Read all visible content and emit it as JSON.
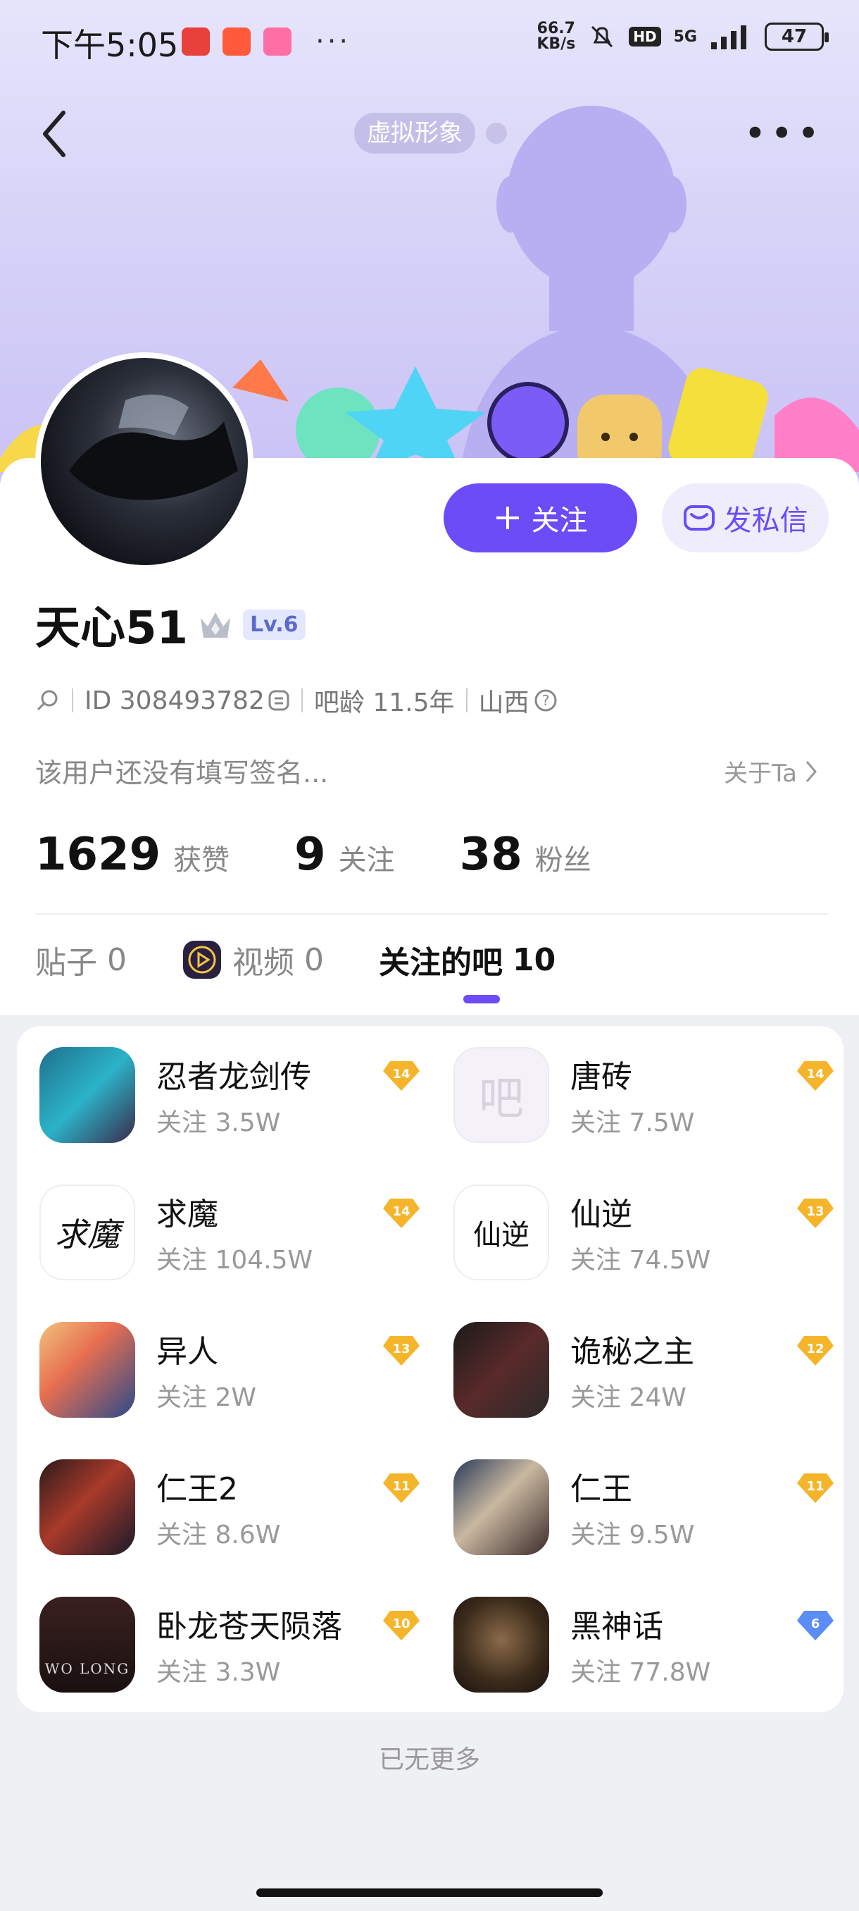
{
  "status_bar": {
    "time": "下午5:05",
    "net_speed_value": "66.7",
    "net_speed_unit": "KB/s",
    "hd": "HD",
    "network": "5G",
    "battery": "47",
    "more": "···"
  },
  "header": {
    "virtual_label": "虚拟形象"
  },
  "profile": {
    "username": "天心51",
    "level": "Lv.6",
    "id_text": "ID 308493782",
    "bar_age": "吧龄 11.5年",
    "location": "山西",
    "signature": "该用户还没有填写签名...",
    "about": "关于Ta",
    "follow_button": "关注",
    "message_button": "发私信"
  },
  "stats": [
    {
      "value": "1629",
      "label": "获赞"
    },
    {
      "value": "9",
      "label": "关注"
    },
    {
      "value": "38",
      "label": "粉丝"
    }
  ],
  "tabs": [
    {
      "label": "贴子",
      "count": "0"
    },
    {
      "label": "视频",
      "count": "0"
    },
    {
      "label": "关注的吧",
      "count": "10"
    }
  ],
  "bars": [
    {
      "name": "忍者龙剑传",
      "follow": "关注 3.5W",
      "level": "14",
      "tier": "gold"
    },
    {
      "name": "唐砖",
      "follow": "关注 7.5W",
      "level": "14",
      "tier": "gold"
    },
    {
      "name": "求魔",
      "follow": "关注 104.5W",
      "level": "14",
      "tier": "gold"
    },
    {
      "name": "仙逆",
      "follow": "关注 74.5W",
      "level": "13",
      "tier": "gold"
    },
    {
      "name": "异人",
      "follow": "关注 2W",
      "level": "13",
      "tier": "gold"
    },
    {
      "name": "诡秘之主",
      "follow": "关注 24W",
      "level": "12",
      "tier": "gold"
    },
    {
      "name": "仁王2",
      "follow": "关注 8.6W",
      "level": "11",
      "tier": "gold"
    },
    {
      "name": "仁王",
      "follow": "关注 9.5W",
      "level": "11",
      "tier": "gold"
    },
    {
      "name": "卧龙苍天陨落",
      "follow": "关注 3.3W",
      "level": "10",
      "tier": "gold"
    },
    {
      "name": "黑神话",
      "follow": "关注 77.8W",
      "level": "6",
      "tier": "blue"
    }
  ],
  "thumb_texts": {
    "tangzhuan": "吧",
    "qiumo": "求魔",
    "xianni": "仙逆",
    "wolong": "WO LONG"
  },
  "footer": {
    "no_more": "已无更多"
  },
  "colors": {
    "accent": "#6b4cf6",
    "gold_badge": "#f5b52a",
    "blue_badge": "#5b8df6"
  }
}
